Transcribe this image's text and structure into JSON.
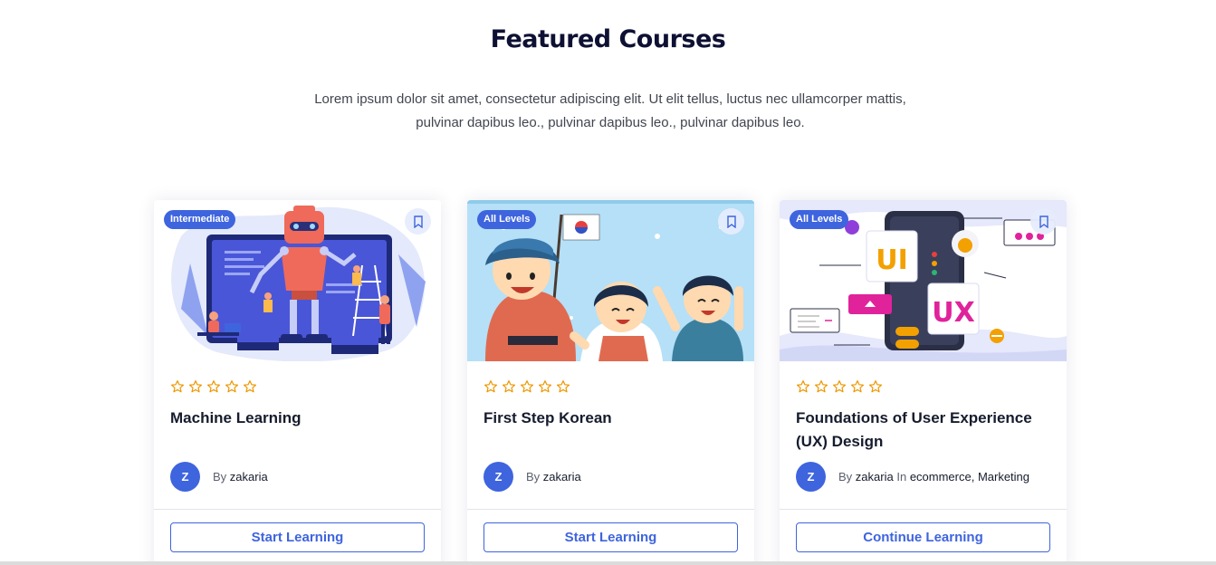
{
  "section": {
    "title": "Featured Courses",
    "subtitle": "Lorem ipsum dolor sit amet, consectetur adipiscing elit. Ut elit tellus, luctus nec ullamcorper mattis, pulvinar dapibus leo., pulvinar dapibus leo., pulvinar dapibus leo."
  },
  "colors": {
    "accent": "#3e64de",
    "star": "#ed9700",
    "title": "#0e1133"
  },
  "courses": [
    {
      "level": "Intermediate",
      "title": "Machine Learning",
      "rating": 0,
      "author_initial": "Z",
      "by_label": "By",
      "author": "zakaria",
      "in_label": "",
      "categories": "",
      "cta": "Start Learning",
      "thumbnail_icon": "robot-illustration"
    },
    {
      "level": "All Levels",
      "title": "First Step Korean",
      "rating": 0,
      "author_initial": "Z",
      "by_label": "By",
      "author": "zakaria",
      "in_label": "",
      "categories": "",
      "cta": "Start Learning",
      "thumbnail_icon": "korean-kids-illustration"
    },
    {
      "level": "All Levels",
      "title": "Foundations of User Experience (UX) Design",
      "rating": 0,
      "author_initial": "Z",
      "by_label": "By",
      "author": "zakaria",
      "in_label": "In",
      "categories": "ecommerce, Marketing",
      "cta": "Continue Learning",
      "thumbnail_icon": "ui-ux-phone-illustration"
    }
  ]
}
